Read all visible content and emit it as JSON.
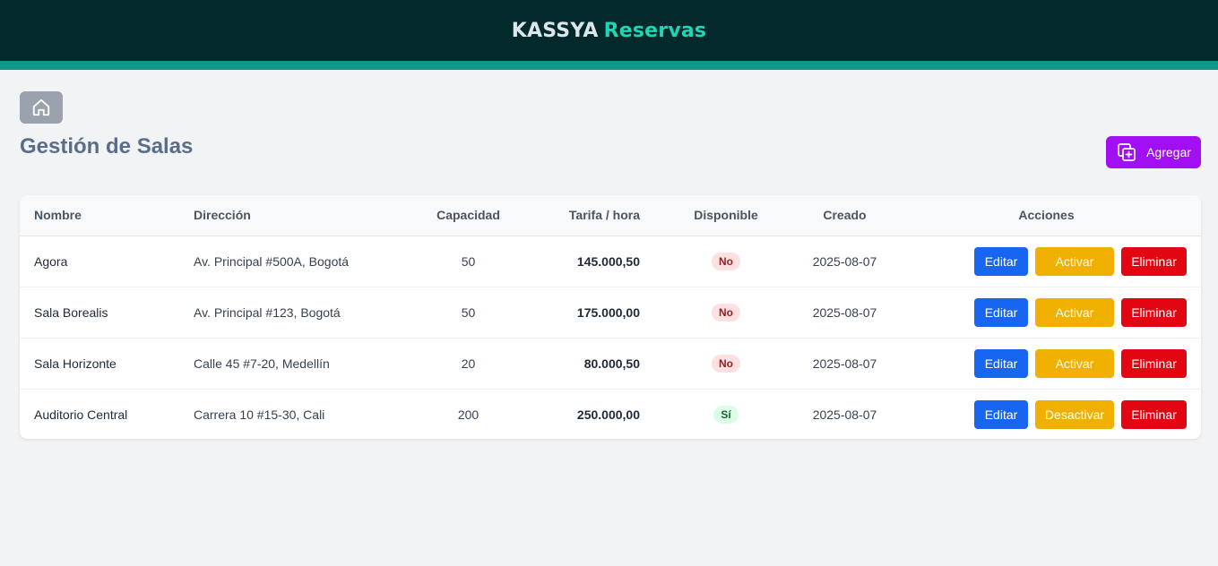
{
  "header": {
    "brand_primary": "KASSYA",
    "brand_secondary": "Reservas"
  },
  "colors": {
    "header_bg": "#03292b",
    "accent_strip": "#0e9a8b",
    "brand_secondary": "#20d4b6",
    "add_button": "#a20ff2",
    "edit_button": "#1865f2",
    "toggle_button": "#f0b000",
    "delete_button": "#e20613"
  },
  "page": {
    "home_icon": "home-icon",
    "title": "Gestión de Salas",
    "add_label": "Agregar",
    "add_icon": "copy-add-icon"
  },
  "table": {
    "columns": [
      "Nombre",
      "Dirección",
      "Capacidad",
      "Tarifa / hora",
      "Disponible",
      "Creado",
      "Acciones"
    ],
    "rows": [
      {
        "name": "Agora",
        "address": "Av. Principal #500A, Bogotá",
        "capacity": "50",
        "rate": "145.000,50",
        "available": "No",
        "created": "2025-08-07",
        "edit": "Editar",
        "toggle": "Activar",
        "delete": "Eliminar"
      },
      {
        "name": "Sala Borealis",
        "address": "Av. Principal #123, Bogotá",
        "capacity": "50",
        "rate": "175.000,00",
        "available": "No",
        "created": "2025-08-07",
        "edit": "Editar",
        "toggle": "Activar",
        "delete": "Eliminar"
      },
      {
        "name": "Sala Horizonte",
        "address": "Calle 45 #7-20, Medellín",
        "capacity": "20",
        "rate": "80.000,50",
        "available": "No",
        "created": "2025-08-07",
        "edit": "Editar",
        "toggle": "Activar",
        "delete": "Eliminar"
      },
      {
        "name": "Auditorio Central",
        "address": "Carrera 10 #15-30, Cali",
        "capacity": "200",
        "rate": "250.000,00",
        "available": "Sí",
        "created": "2025-08-07",
        "edit": "Editar",
        "toggle": "Desactivar",
        "delete": "Eliminar"
      }
    ]
  }
}
